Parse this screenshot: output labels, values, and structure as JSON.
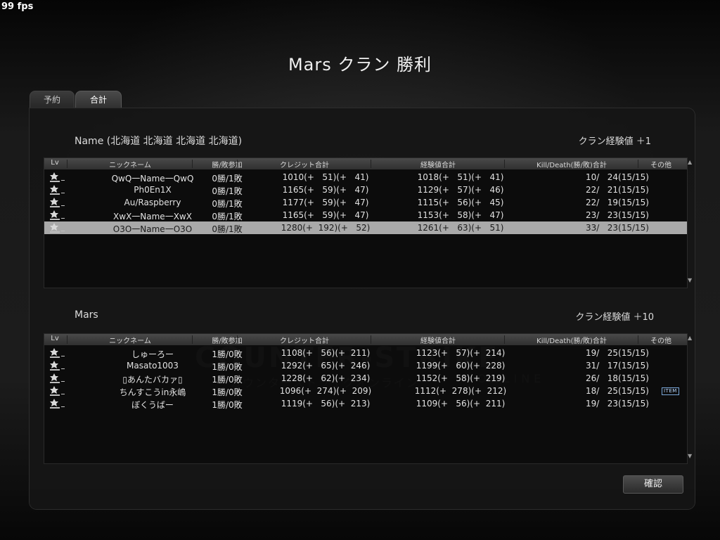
{
  "fps": "99 fps",
  "title": "Mars クラン 勝利",
  "tabs": [
    {
      "label": "予約",
      "active": false
    },
    {
      "label": "合計",
      "active": true
    }
  ],
  "columns": {
    "lv": "Lv",
    "nick": "ニックネーム",
    "wl": "勝/敗参加",
    "credit": "クレジット合計",
    "exp": "経験値合計",
    "kd": "Kill/Death(勝/敗)合計",
    "other": "その他"
  },
  "team1": {
    "name": "Name   (北海道 北海道 北海道 北海道)",
    "exp": "クラン経験値 ＋1",
    "rows": [
      {
        "nick": "QwQ一Name一QwQ",
        "wl": "0勝/1敗",
        "credit": "1010(+   51)(+   41)",
        "exp": "1018(+   51)(+   41)",
        "kd": "10/   24(15/15)",
        "selected": false
      },
      {
        "nick": "Ph0En1X",
        "wl": "0勝/1敗",
        "credit": "1165(+   59)(+   47)",
        "exp": "1129(+   57)(+   46)",
        "kd": "22/   21(15/15)",
        "selected": false
      },
      {
        "nick": "Au/Raspberry",
        "wl": "0勝/1敗",
        "credit": "1177(+   59)(+   47)",
        "exp": "1115(+   56)(+   45)",
        "kd": "22/   19(15/15)",
        "selected": false
      },
      {
        "nick": "XwX一Name一XwX",
        "wl": "0勝/1敗",
        "credit": "1165(+   59)(+   47)",
        "exp": "1153(+   58)(+   47)",
        "kd": "23/   23(15/15)",
        "selected": false
      },
      {
        "nick": "O3O一Name一O3O",
        "wl": "0勝/1敗",
        "credit": "1280(+  192)(+   52)",
        "exp": "1261(+   63)(+   51)",
        "kd": "33/   23(15/15)",
        "selected": true
      }
    ]
  },
  "team2": {
    "name": "Mars",
    "exp": "クラン経験値 ＋10",
    "rows": [
      {
        "nick": "しゅーろー",
        "wl": "1勝/0敗",
        "credit": "1108(+   56)(+  211)",
        "exp": "1123(+   57)(+  214)",
        "kd": "19/   25(15/15)",
        "item": ""
      },
      {
        "nick": "Masato1003",
        "wl": "1勝/0敗",
        "credit": "1292(+   65)(+  246)",
        "exp": "1199(+   60)(+  228)",
        "kd": "31/   17(15/15)",
        "item": ""
      },
      {
        "nick": "▯あんたバカァ▯",
        "wl": "1勝/0敗",
        "credit": "1228(+   62)(+  234)",
        "exp": "1152(+   58)(+  219)",
        "kd": "26/   18(15/15)",
        "item": ""
      },
      {
        "nick": "ちんすこうin永嶋",
        "wl": "1勝/0敗",
        "credit": "1096(+  274)(+  209)",
        "exp": "1112(+  278)(+  212)",
        "kd": "18/   25(15/15)",
        "item": "ITEM"
      },
      {
        "nick": "ぼくうばー",
        "wl": "1勝/0敗",
        "credit": "1119(+   56)(+  213)",
        "exp": "1109(+   56)(+  211)",
        "kd": "19/   23(15/15)",
        "item": ""
      }
    ]
  },
  "watermark": {
    "brand": "COUNTER-STRIKE",
    "sub": "ONLINE",
    "kana": "カウンターストライクオンライン"
  },
  "confirm_label": "確認"
}
